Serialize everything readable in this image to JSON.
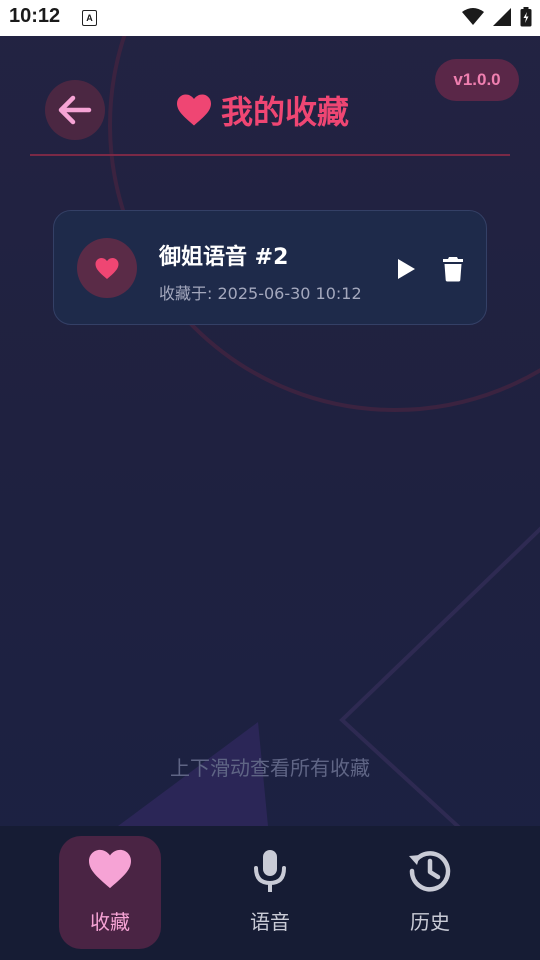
{
  "status_bar": {
    "time": "10:12",
    "notification_glyph": "A"
  },
  "header": {
    "title": "我的收藏",
    "version": "v1.0.0"
  },
  "favorites": [
    {
      "title": "御姐语音 #2",
      "saved_at": "收藏于: 2025-06-30 10:12"
    }
  ],
  "scroll_hint": "上下滑动查看所有收藏",
  "bottom_nav": [
    {
      "label": "收藏",
      "icon": "heart-icon",
      "active": true
    },
    {
      "label": "语音",
      "icon": "microphone-icon",
      "active": false
    },
    {
      "label": "历史",
      "icon": "history-icon",
      "active": false
    }
  ],
  "colors": {
    "accent": "#ef4673",
    "pink_light": "#f6a3d5",
    "background": "#1f2140",
    "card": "#1e2a4a"
  }
}
